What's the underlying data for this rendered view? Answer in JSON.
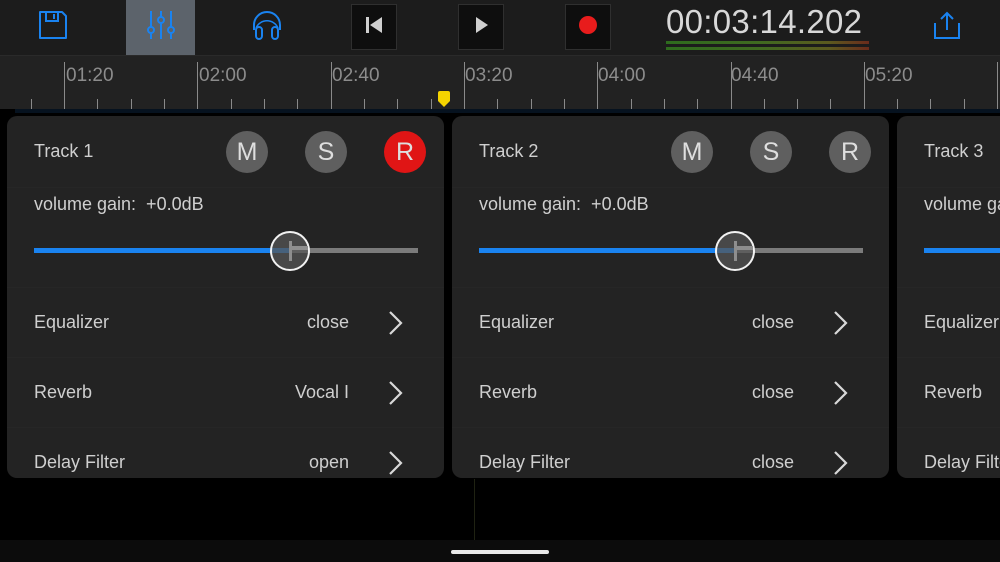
{
  "toolbar": {
    "buttons": [
      {
        "name": "save",
        "icon": "floppy-disk-icon",
        "active": false
      },
      {
        "name": "mixer",
        "icon": "sliders-icon",
        "active": true
      },
      {
        "name": "monitor",
        "icon": "headphones-icon",
        "active": false
      }
    ],
    "transport": {
      "previous_icon": "skip-back-icon",
      "play_icon": "play-icon",
      "record_icon": "record-icon"
    },
    "timecode": "00:03:14.202",
    "share_icon": "share-upload-icon",
    "accent_color": "#1a83f0",
    "record_color": "#e01515"
  },
  "ruler": {
    "labels": [
      "01:20",
      "02:00",
      "02:40",
      "03:20",
      "04:00",
      "04:40",
      "05:20"
    ],
    "playhead_icon": "playhead-marker-icon",
    "playhead_color": "#f5d400"
  },
  "tracks": [
    {
      "title": "Track 1",
      "mute_label": "M",
      "solo_label": "S",
      "record_label": "R",
      "record_armed": true,
      "gain_label": "volume gain:  +0.0dB",
      "gain_fraction": 0.667,
      "effects": [
        {
          "name": "Equalizer",
          "value": "close"
        },
        {
          "name": "Reverb",
          "value": "Vocal I"
        },
        {
          "name": "Delay Filter",
          "value": "open"
        }
      ]
    },
    {
      "title": "Track 2",
      "mute_label": "M",
      "solo_label": "S",
      "record_label": "R",
      "record_armed": false,
      "gain_label": "volume gain:  +0.0dB",
      "gain_fraction": 0.667,
      "effects": [
        {
          "name": "Equalizer",
          "value": "close"
        },
        {
          "name": "Reverb",
          "value": "close"
        },
        {
          "name": "Delay Filter",
          "value": "close"
        }
      ]
    },
    {
      "title": "Track 3",
      "gain_label": "volume gain",
      "gain_fraction": 0.667,
      "effects": [
        {
          "name": "Equalizer"
        },
        {
          "name": "Reverb"
        },
        {
          "name": "Delay Filter"
        }
      ]
    }
  ]
}
